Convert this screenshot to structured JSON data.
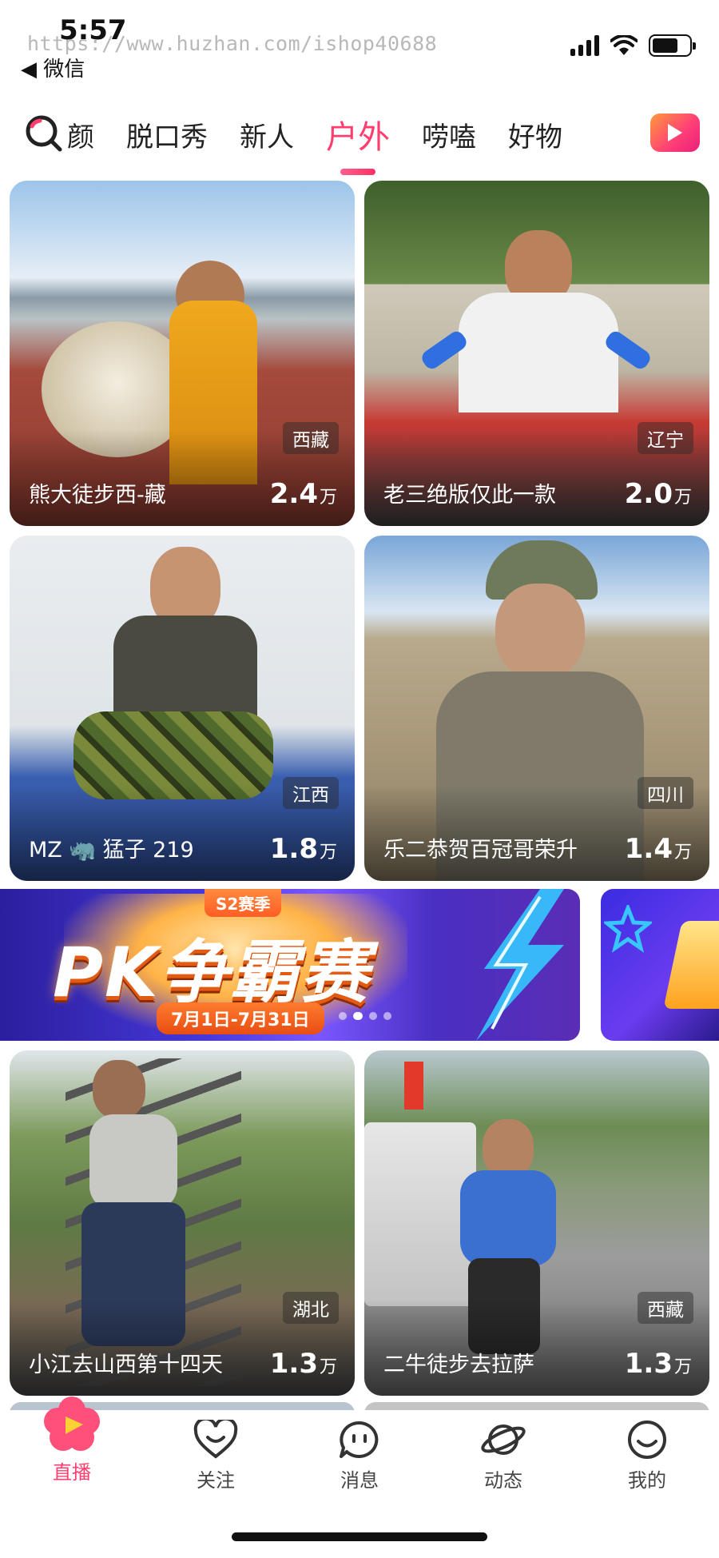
{
  "status_bar": {
    "time": "5:57",
    "watermark": "https://www.huzhan.com/ishop40688",
    "back_app": "◀ 微信"
  },
  "tabs": {
    "items": [
      "颜",
      "脱口秀",
      "新人",
      "户外",
      "唠嗑",
      "好物"
    ],
    "active": "户外"
  },
  "cards": [
    {
      "title": "熊大徒步西-藏",
      "region": "西藏",
      "viewers": "2.4",
      "unit": "万"
    },
    {
      "title": "老三绝版仅此一款",
      "region": "辽宁",
      "viewers": "2.0",
      "unit": "万"
    },
    {
      "title": "MZ 🦏 猛子 219",
      "region": "江西",
      "viewers": "1.8",
      "unit": "万"
    },
    {
      "title": "乐二恭贺百冠哥荣升",
      "region": "四川",
      "viewers": "1.4",
      "unit": "万"
    },
    {
      "title": "小江去山西第十四天",
      "region": "湖北",
      "viewers": "1.3",
      "unit": "万"
    },
    {
      "title": "二牛徒步去拉萨",
      "region": "西藏",
      "viewers": "1.3",
      "unit": "万"
    }
  ],
  "banner": {
    "season": "S2赛季",
    "headline": "PK争霸赛",
    "dates": "7月1日-7月31日",
    "page_index": 2,
    "page_count": 4
  },
  "bottom_nav": {
    "items": [
      "直播",
      "关注",
      "消息",
      "动态",
      "我的"
    ],
    "active": "直播"
  },
  "colors": {
    "accent": "#ff3d6e"
  }
}
